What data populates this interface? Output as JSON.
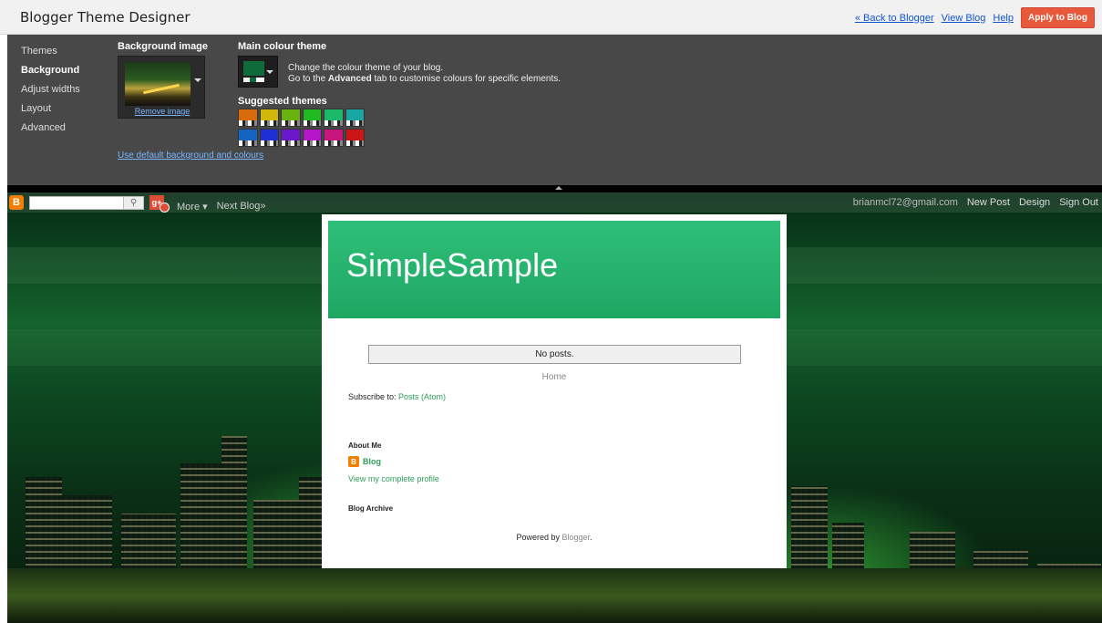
{
  "header": {
    "title": "Blogger Theme Designer",
    "back_link": "« Back to Blogger",
    "view_blog": "View Blog",
    "help": "Help",
    "apply": "Apply to Blog"
  },
  "designer": {
    "nav": [
      "Themes",
      "Background",
      "Adjust widths",
      "Layout",
      "Advanced"
    ],
    "active_nav": "Background",
    "bg_image_label": "Background image",
    "remove_image": "Remove image",
    "colour_label": "Main colour theme",
    "colour_desc_1": "Change the colour theme of your blog.",
    "colour_desc_2_pre": "Go to the ",
    "colour_desc_2_bold": "Advanced",
    "colour_desc_2_post": " tab to customise colours for specific elements.",
    "suggested_label": "Suggested themes",
    "swatches": [
      "#d96b0c",
      "#d1b70a",
      "#69b30c",
      "#1fba1f",
      "#1db96b",
      "#1aa7a3",
      "#1565c0",
      "#1f2fd6",
      "#6a18c9",
      "#b416c9",
      "#c8167e",
      "#cc1515"
    ],
    "use_default": "Use default background and colours"
  },
  "navbar": {
    "more": "More ▾",
    "next_blog": "Next Blog»",
    "email": "brianmcl72@gmail.com",
    "new_post": "New Post",
    "design": "Design",
    "sign_out": "Sign Out"
  },
  "blog": {
    "title": "SimpleSample",
    "no_posts": "No posts.",
    "home": "Home",
    "subscribe_label": "Subscribe to: ",
    "subscribe_link": "Posts (Atom)",
    "about_me": "About Me",
    "profile_name": "Blog",
    "profile_link": "View my complete profile",
    "blog_archive": "Blog Archive",
    "powered_label": "Powered by ",
    "powered_link": "Blogger",
    "powered_suffix": "."
  }
}
